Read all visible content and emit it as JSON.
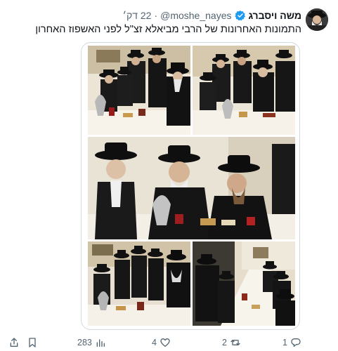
{
  "author": {
    "display_name": "משה ויסברג",
    "handle": "@moshe_nayes",
    "time": "22 דק׳",
    "separator": "·",
    "verified_color": "#1d9bf0"
  },
  "tweet": {
    "text": "התמונות האחרונות של הרבי מביאלא זצ\"ל לפני האשפוז האחרון"
  },
  "media": {
    "photo_count": 5
  },
  "actions": {
    "replies": "1",
    "retweets": "2",
    "likes": "4",
    "views": "283"
  },
  "icons": [
    "verified-icon",
    "reply-icon",
    "retweet-icon",
    "like-icon",
    "views-icon",
    "bookmark-icon",
    "share-icon"
  ]
}
